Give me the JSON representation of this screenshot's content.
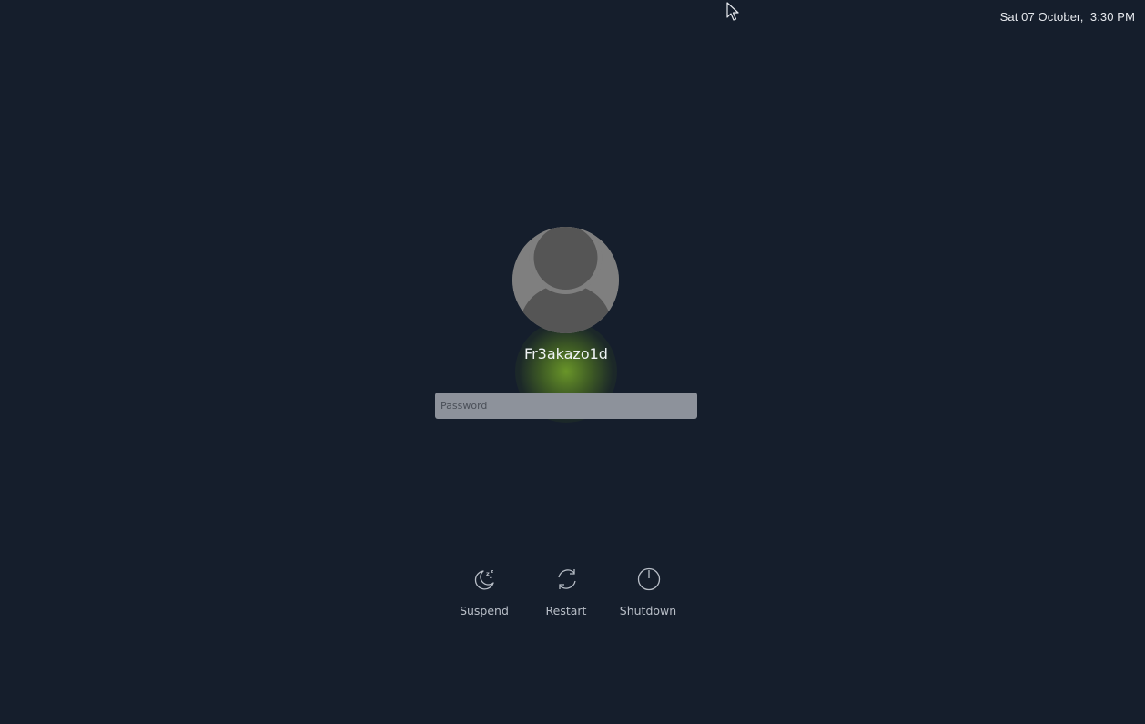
{
  "clock": {
    "text": "Sat 07 October,  3:30 PM"
  },
  "user": {
    "name": "Fr3akazo1d",
    "avatar_icon": "user-avatar-icon"
  },
  "login": {
    "password_placeholder": "Password"
  },
  "power_actions": [
    {
      "label": "Suspend",
      "icon": "moon-sleep-icon"
    },
    {
      "label": "Restart",
      "icon": "restart-icon"
    },
    {
      "label": "Shutdown",
      "icon": "power-icon"
    }
  ],
  "colors": {
    "background": "#151e2c",
    "text": "#eef2f4",
    "glow": "#78aa28",
    "field": "#8d929b"
  }
}
